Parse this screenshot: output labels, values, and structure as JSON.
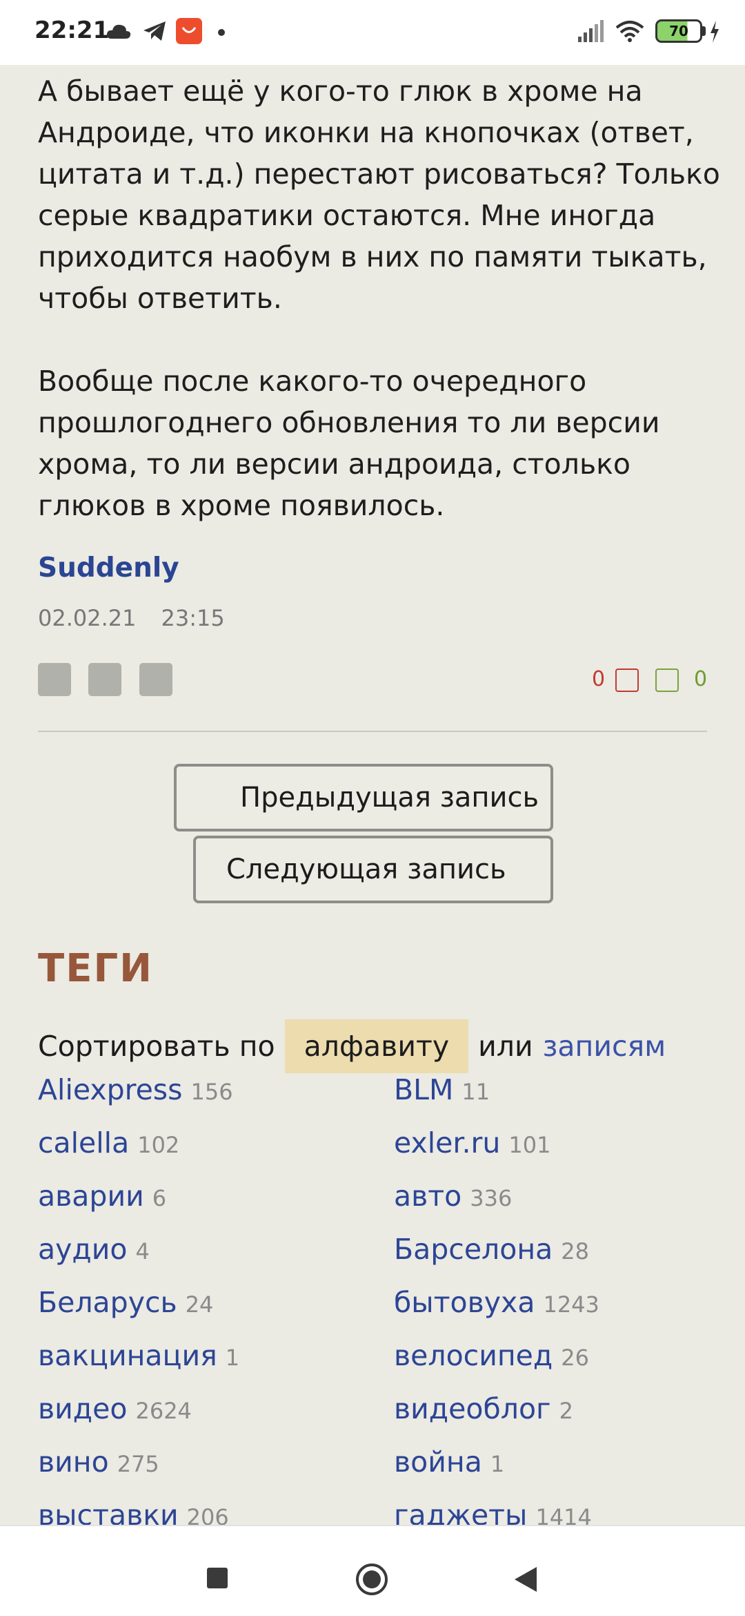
{
  "status_bar": {
    "time": "22:21",
    "battery": "70",
    "icons": [
      "cloud-icon",
      "telegram-icon",
      "aliexpress-icon",
      "dot-icon",
      "signal-icon",
      "wifi-icon",
      "battery-icon",
      "charging-icon"
    ]
  },
  "comment": {
    "paragraph1": "А бывает ещё у кого-то глюк в хроме на\nАндроиде, что иконки на кнопочках (ответ,\nцитата и т.д.) перестают рисоваться? Только\nсерые квадратики остаются. Мне иногда\nприходится наобум в них по памяти тыкать,\nчтобы ответить.",
    "paragraph2": "Вообще после какого-то очередного\nпрошлогоднего обновления то ли версии\nхрома, то ли версии андроида, столько\nглюков в хроме появилось.",
    "author": "Suddenly",
    "date": "02.02.21",
    "time": "23:15",
    "votes_down": "0",
    "votes_up": "0"
  },
  "navigation": {
    "prev_label": "Предыдущая запись",
    "next_label": "Следующая запись"
  },
  "tags": {
    "heading": "ТЕГИ",
    "sort_label": "Сортировать по",
    "sort_active": "алфавиту",
    "sort_or": "или",
    "sort_other": "записям",
    "items": [
      {
        "name": "Aliexpress",
        "count": "156"
      },
      {
        "name": "BLM",
        "count": "11"
      },
      {
        "name": "calella",
        "count": "102"
      },
      {
        "name": "exler.ru",
        "count": "101"
      },
      {
        "name": "аварии",
        "count": "6"
      },
      {
        "name": "авто",
        "count": "336"
      },
      {
        "name": "аудио",
        "count": "4"
      },
      {
        "name": "Барселона",
        "count": "28"
      },
      {
        "name": "Беларусь",
        "count": "24"
      },
      {
        "name": "бытовуха",
        "count": "1243"
      },
      {
        "name": "вакцинация",
        "count": "1"
      },
      {
        "name": "велосипед",
        "count": "26"
      },
      {
        "name": "видео",
        "count": "2624"
      },
      {
        "name": "видеоблог",
        "count": "2"
      },
      {
        "name": "вино",
        "count": "275"
      },
      {
        "name": "война",
        "count": "1"
      },
      {
        "name": "выставки",
        "count": "206"
      },
      {
        "name": "гаджеты",
        "count": "1414"
      }
    ]
  },
  "colors": {
    "background": "#ebeae3",
    "link": "#2c4595",
    "heading": "#97573a",
    "vote_down": "#c33a2f",
    "vote_up": "#6f9b31",
    "sort_highlight": "#ecdcae"
  }
}
